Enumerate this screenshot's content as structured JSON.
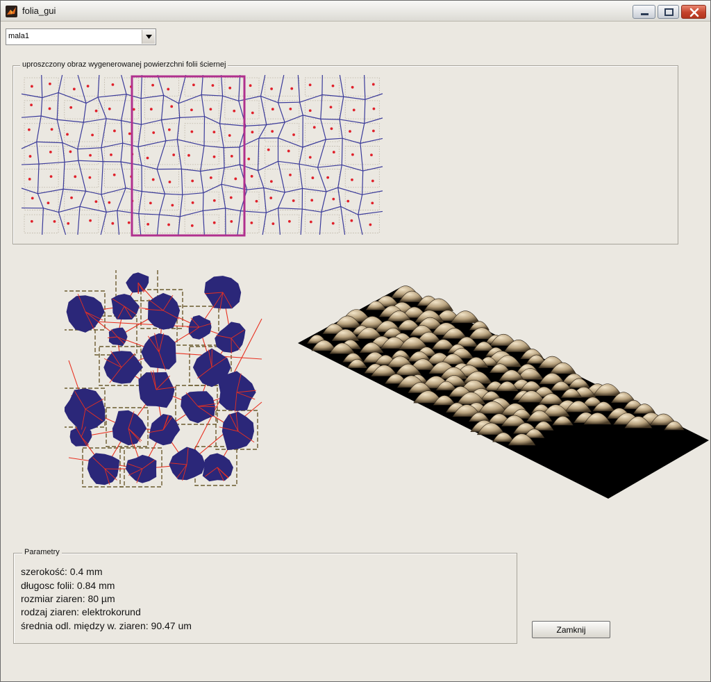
{
  "window": {
    "title": "folia_gui",
    "app_icon": "matlab-icon",
    "controls": {
      "minimize": "minimize-icon",
      "maximize": "maximize-icon",
      "close": "close-icon"
    }
  },
  "dropdown": {
    "selected": "mala1",
    "arrow_icon": "chevron-down-icon"
  },
  "preview_panel": {
    "title": "uproszczony obraz wygenerowanej powierzchni folii ściernej",
    "cells_color": "#3a3a9a",
    "seed_color": "#e0202a",
    "selection_color": "#b0308e"
  },
  "grain_plot": {
    "grain_color": "#2b2779",
    "triangulation_color": "#e83020",
    "box_color": "#6b5a2e"
  },
  "surface_plot": {
    "base_color": "#000000",
    "grain_color": "#b8a27e"
  },
  "params_panel": {
    "title": "Parametry",
    "lines": [
      "szerokość: 0.4 mm",
      "długosc folii: 0.84 mm",
      "rozmiar ziaren: 80 µm",
      "rodzaj ziaren: elektrokorund",
      "średnia odl. między w. ziaren: 90.47 um"
    ]
  },
  "close_button": {
    "label": "Zamknij"
  }
}
